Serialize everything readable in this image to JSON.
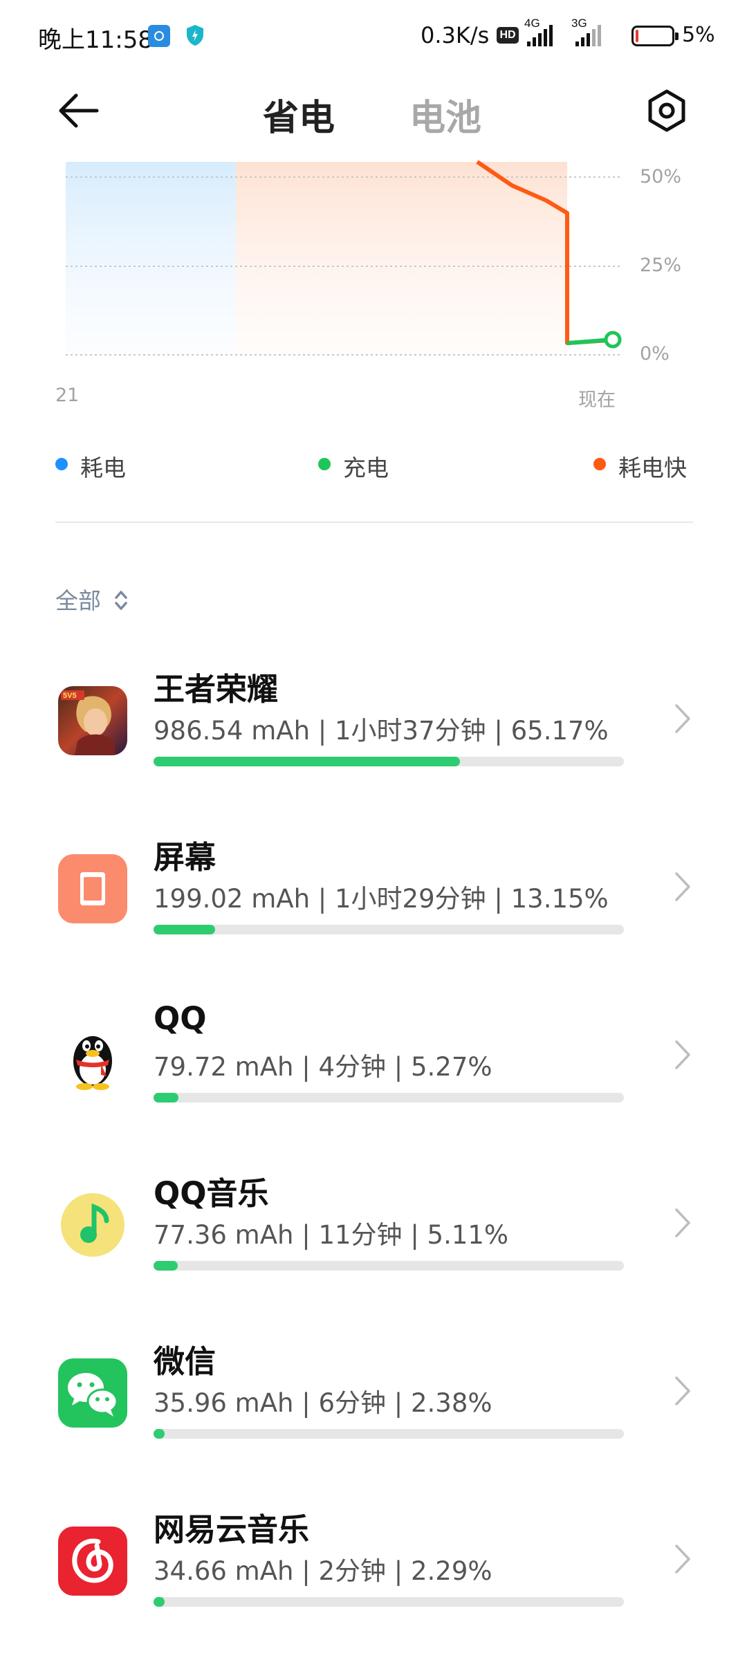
{
  "status_bar": {
    "time": "晚上11:58",
    "net_speed": "0.3K/s",
    "hd": "HD",
    "net1": "4G",
    "net2": "3G",
    "battery_text": "5%"
  },
  "header": {
    "tab_active": "省电",
    "tab_inactive": "电池"
  },
  "chart": {
    "tick_50": "50%",
    "tick_25": "25%",
    "tick_0": "0%",
    "x_start": "21",
    "x_end": "现在"
  },
  "legend": {
    "drain": "耗电",
    "charge": "充电",
    "fast_drain": "耗电快",
    "colors": {
      "drain": "#1e90ff",
      "charge": "#1fc55a",
      "fast_drain": "#ff5a14"
    }
  },
  "filter": {
    "label": "全部"
  },
  "apps": [
    {
      "name": "王者荣耀",
      "detail": "986.54 mAh | 1小时37分钟 | 65.17%",
      "percent": 65.17,
      "icon": "honor-of-kings-icon"
    },
    {
      "name": "屏幕",
      "detail": "199.02 mAh | 1小时29分钟 | 13.15%",
      "percent": 13.15,
      "icon": "screen-icon"
    },
    {
      "name": "QQ",
      "detail": "79.72 mAh | 4分钟 | 5.27%",
      "percent": 5.27,
      "icon": "qq-penguin-icon"
    },
    {
      "name": "QQ音乐",
      "detail": "77.36 mAh | 11分钟 | 5.11%",
      "percent": 5.11,
      "icon": "qq-music-icon"
    },
    {
      "name": "微信",
      "detail": "35.96 mAh | 6分钟 | 2.38%",
      "percent": 2.38,
      "icon": "wechat-icon"
    },
    {
      "name": "网易云音乐",
      "detail": "34.66 mAh | 2分钟 | 2.29%",
      "percent": 2.29,
      "icon": "netease-music-icon"
    }
  ]
}
